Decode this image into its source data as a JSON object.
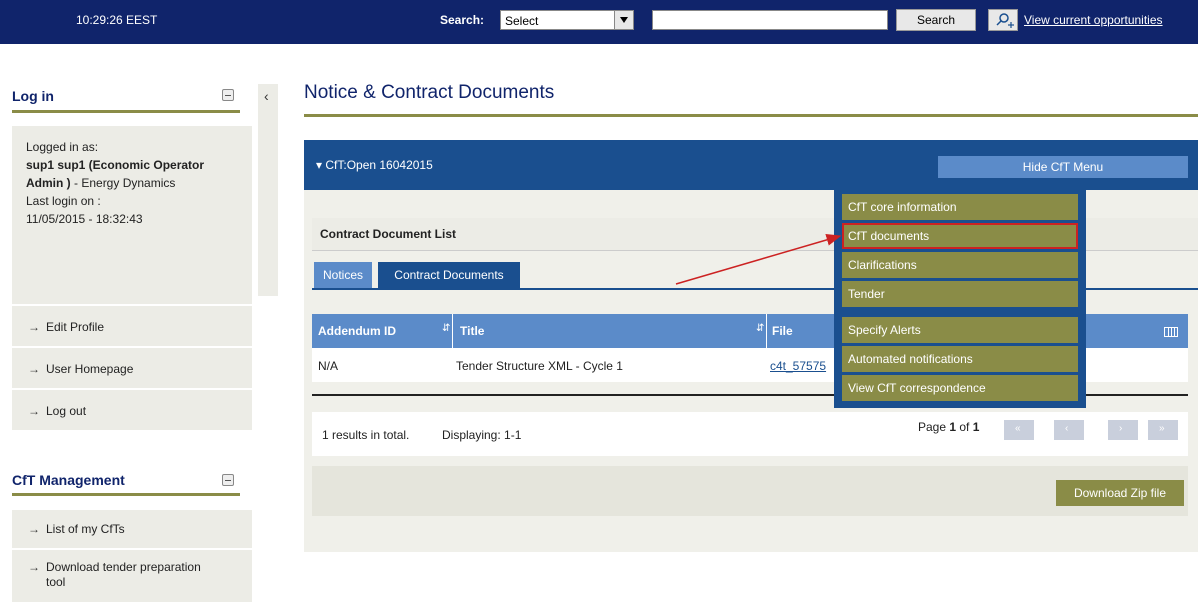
{
  "topbar": {
    "clock": "10:29:26 EEST",
    "search_label": "Search:",
    "search_select_value": "Select",
    "search_button": "Search",
    "opportunities_link": "View current opportunities"
  },
  "login": {
    "title": "Log in",
    "logged_in_as_label": "Logged in as:",
    "user_bold": "sup1 sup1 (Economic Operator Admin )",
    "user_org": " - Energy Dynamics",
    "last_login_label": "Last login on :",
    "last_login_value": "11/05/2015 - 18:32:43",
    "links": [
      "Edit Profile",
      "User Homepage",
      "Log out"
    ]
  },
  "cft_management": {
    "title": "CfT Management",
    "links": [
      "List of my CfTs",
      "Download tender preparation tool"
    ]
  },
  "main": {
    "title": "Notice & Contract Documents",
    "cft_label": "CfT:Open 16042015",
    "hide_menu": "Hide CfT Menu",
    "list_title": "Contract Document List",
    "tabs": [
      "Notices",
      "Contract Documents"
    ],
    "columns": [
      "Addendum ID",
      "Title",
      "File"
    ],
    "row": {
      "addendum_id": "N/A",
      "title": "Tender Structure XML - Cycle 1",
      "file": "c4t_57575"
    },
    "results_total": "1 results in total.",
    "displaying": "Displaying: 1-1",
    "page_prefix": "Page ",
    "page_current": "1",
    "page_of": " of ",
    "page_total": "1",
    "download_zip": "Download Zip file"
  },
  "cft_menu": {
    "items": [
      "CfT core information",
      "CfT documents",
      "Clarifications",
      "Tender",
      "Specify Alerts",
      "Automated notifications",
      "View CfT correspondence"
    ],
    "active_index": 1
  },
  "colors": {
    "header_navy": "#10246b",
    "panel_blue": "#1a4f8f",
    "light_blue": "#5b8bc9",
    "olive": "#8a8c47",
    "highlight_red": "#cc2222"
  }
}
